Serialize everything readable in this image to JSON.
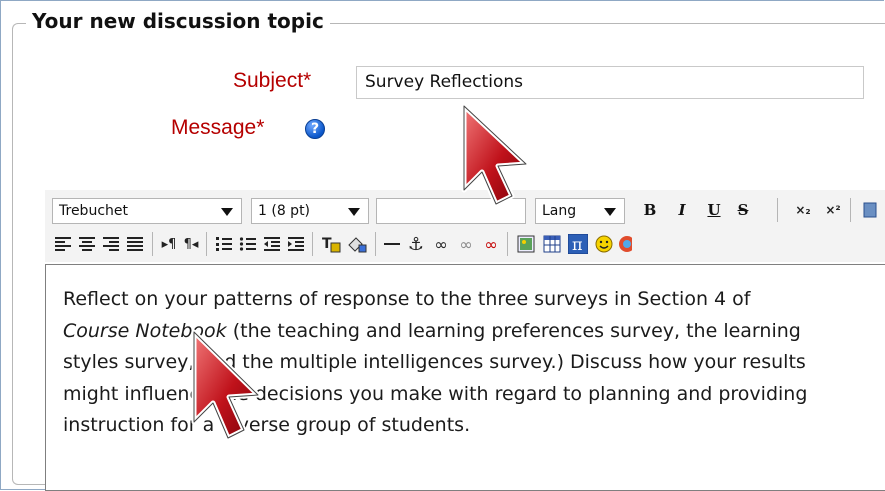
{
  "form": {
    "legend": "Your new discussion topic",
    "subject_label": "Subject*",
    "subject_value": "Survey Reflections",
    "message_label": "Message*",
    "help_icon": "help-question-icon"
  },
  "toolbar": {
    "font_family": "Trebuchet",
    "font_size": "1 (8 pt)",
    "format": "",
    "lang": "Lang",
    "bold": "B",
    "italic": "I",
    "underline": "U",
    "strikethrough": "S"
  },
  "editor": {
    "line1": "Reflect on your patterns of response to the three surveys in Section 4 of",
    "line2_italic": "Course Notebook",
    "line2_rest": " (the teaching and learning preferences survey, the learning",
    "line3": "styles survey, and the multiple intelligences survey.) Discuss how your results",
    "line4": "might influence the decisions you make with regard to planning and providing",
    "line5": "instruction for a diverse group of students."
  },
  "colors": {
    "label_red": "#b50000",
    "cursor_red": "#c0121b"
  }
}
